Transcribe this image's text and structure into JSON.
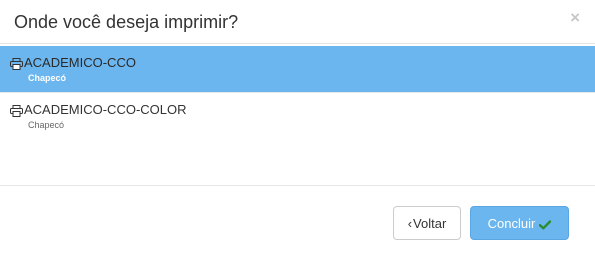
{
  "dialog": {
    "title": "Onde você deseja imprimir?",
    "close_label": "×"
  },
  "printers": [
    {
      "name": "ACADEMICO-CCO",
      "location": "Chapecó",
      "selected": true,
      "icon": "printer-icon"
    },
    {
      "name": "ACADEMICO-CCO-COLOR",
      "location": "Chapecó",
      "selected": false,
      "icon": "printer-icon"
    }
  ],
  "buttons": {
    "back_label": "Voltar",
    "finish_label": "Concluir",
    "back_icon": "chevron-left-icon",
    "finish_icon": "check-icon"
  },
  "colors": {
    "selected_bg": "#6cb6ef",
    "primary": "#6cb6ef",
    "check": "#2e8b2e"
  }
}
